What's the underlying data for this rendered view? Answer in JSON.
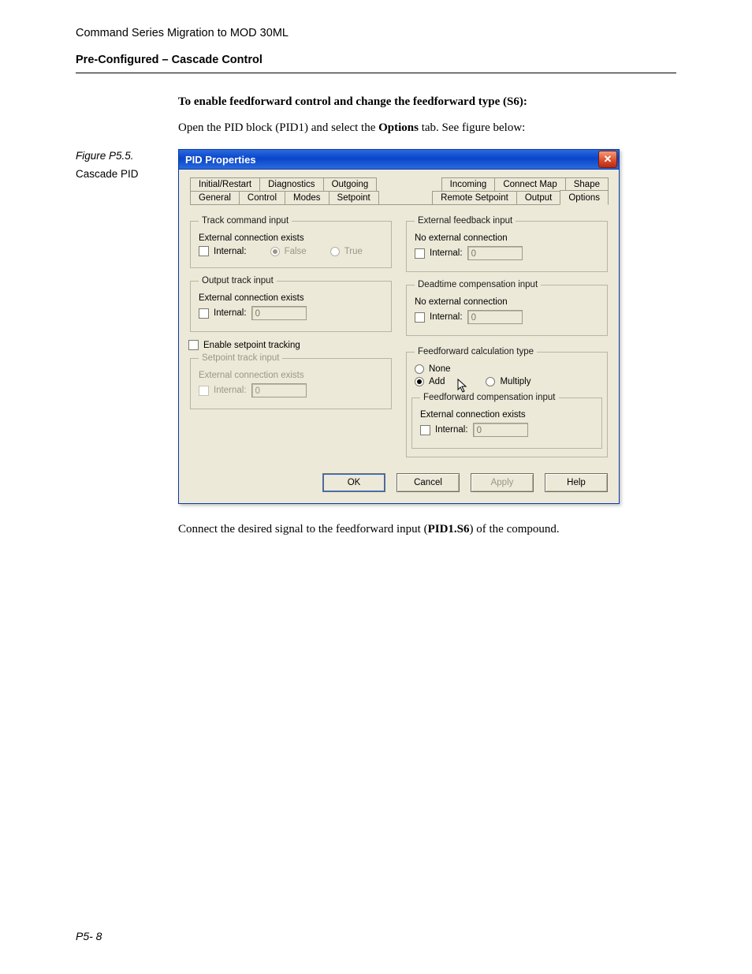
{
  "doc": {
    "header": "Command Series Migration to MOD 30ML",
    "section": "Pre-Configured – Cascade Control",
    "lead": "To enable feedforward control and change the feedforward type (S6):",
    "intro_a": "Open the PID block (PID1) and select the ",
    "intro_b": "Options",
    "intro_c": " tab. See figure below:",
    "figure_num": "Figure P5.5.",
    "figure_title": "Cascade PID",
    "after_a": "Connect the desired signal to the feedforward input (",
    "after_b": "PID1.S6",
    "after_c": ") of the compound.",
    "pagenum": "P5- 8"
  },
  "dialog": {
    "title": "PID Properties",
    "tabs_row1": [
      "Initial/Restart",
      "Diagnostics",
      "Outgoing",
      "Incoming",
      "Connect Map",
      "Shape"
    ],
    "tabs_row2": [
      "General",
      "Control",
      "Modes",
      "Setpoint",
      "Remote Setpoint",
      "Output",
      "Options"
    ],
    "groups": {
      "track_cmd": {
        "legend": "Track command input",
        "status": "External connection exists",
        "internal": "Internal:",
        "false": "False",
        "true": "True"
      },
      "out_track": {
        "legend": "Output track input",
        "status": "External connection exists",
        "internal": "Internal:",
        "val": "0"
      },
      "enable_sp": {
        "label": "Enable setpoint tracking"
      },
      "sp_track": {
        "legend": "Setpoint track input",
        "status": "External connection exists",
        "internal": "Internal:",
        "val": "0"
      },
      "ext_fb": {
        "legend": "External feedback input",
        "status": "No external connection",
        "internal": "Internal:",
        "val": "0"
      },
      "deadtime": {
        "legend": "Deadtime compensation input",
        "status": "No external connection",
        "internal": "Internal:",
        "val": "0"
      },
      "ff_type": {
        "legend": "Feedforward calculation type",
        "none": "None",
        "add": "Add",
        "multiply": "Multiply"
      },
      "ff_comp": {
        "legend": "Feedforward compensation input",
        "status": "External connection exists",
        "internal": "Internal:",
        "val": "0"
      }
    },
    "buttons": {
      "ok": "OK",
      "cancel": "Cancel",
      "apply": "Apply",
      "help": "Help"
    }
  }
}
